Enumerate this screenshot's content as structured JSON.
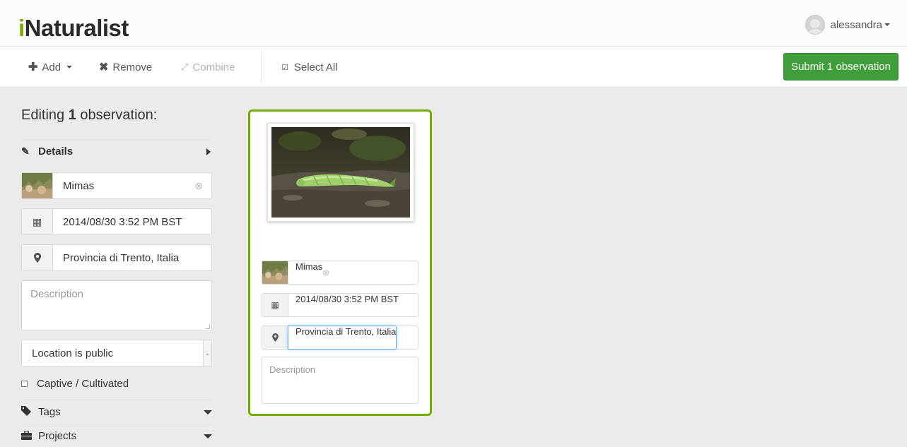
{
  "header": {
    "logo": "Naturalist",
    "logo_i": "i",
    "username": "alessandra"
  },
  "toolbar": {
    "add_label": "Add",
    "remove_label": "Remove",
    "combine_label": "Combine",
    "select_all_label": "Select All",
    "submit_label": "Submit 1 observation",
    "submit_color": "#3f9d3a"
  },
  "sidebar": {
    "title_prefix": "Editing ",
    "title_count": "1",
    "title_suffix": " observation:",
    "details_label": "Details",
    "taxon": "Mimas",
    "datetime": "2014/08/30 3:52 PM BST",
    "location": "Provincia di Trento, Italia",
    "description_placeholder": "Description",
    "geoprivacy": "Location is public",
    "captive_label": "Captive / Cultivated",
    "tags_label": "Tags",
    "projects_label": "Projects"
  },
  "card": {
    "taxon": "Mimas",
    "datetime": "2014/08/30 3:52 PM BST",
    "location": "Provincia di Trento, Italia",
    "description_placeholder": "Description",
    "selected_border_color": "#74ac00"
  },
  "icons": {
    "add": "plus-icon",
    "remove": "x-icon",
    "combine": "combine-icon",
    "select_all": "checkbox-icon",
    "details": "pencil-icon",
    "calendar": "calendar-icon",
    "location": "map-marker-icon",
    "tags": "tag-icon",
    "projects": "briefcase-icon"
  }
}
